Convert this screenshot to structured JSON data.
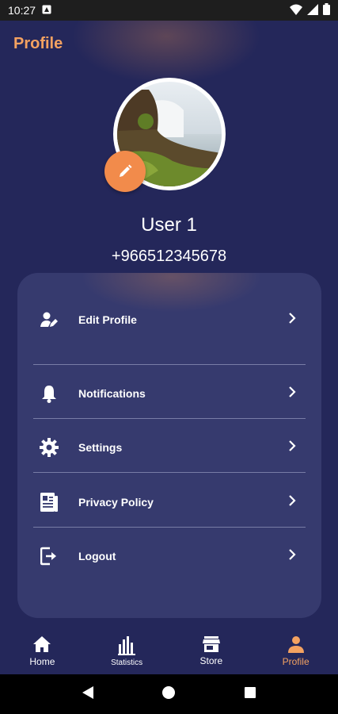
{
  "status": {
    "time": "10:27"
  },
  "header": {
    "title": "Profile"
  },
  "profile": {
    "name": "User 1",
    "phone": "+966512345678"
  },
  "menu": {
    "items": [
      {
        "label": "Edit Profile",
        "icon": "edit-user-icon"
      },
      {
        "label": "Notifications",
        "icon": "bell-icon"
      },
      {
        "label": "Settings",
        "icon": "gear-icon"
      },
      {
        "label": "Privacy Policy",
        "icon": "document-icon"
      },
      {
        "label": "Logout",
        "icon": "logout-icon"
      }
    ]
  },
  "bottom_nav": {
    "items": [
      {
        "label": "Home",
        "icon": "home-icon"
      },
      {
        "label": "Statistics",
        "icon": "bar-chart-icon"
      },
      {
        "label": "Store",
        "icon": "store-icon"
      },
      {
        "label": "Profile",
        "icon": "person-icon"
      }
    ],
    "active": "Profile"
  },
  "colors": {
    "background": "#24275a",
    "card": "#363a6e",
    "accent": "#f4a261",
    "fab": "#f28b4b"
  }
}
